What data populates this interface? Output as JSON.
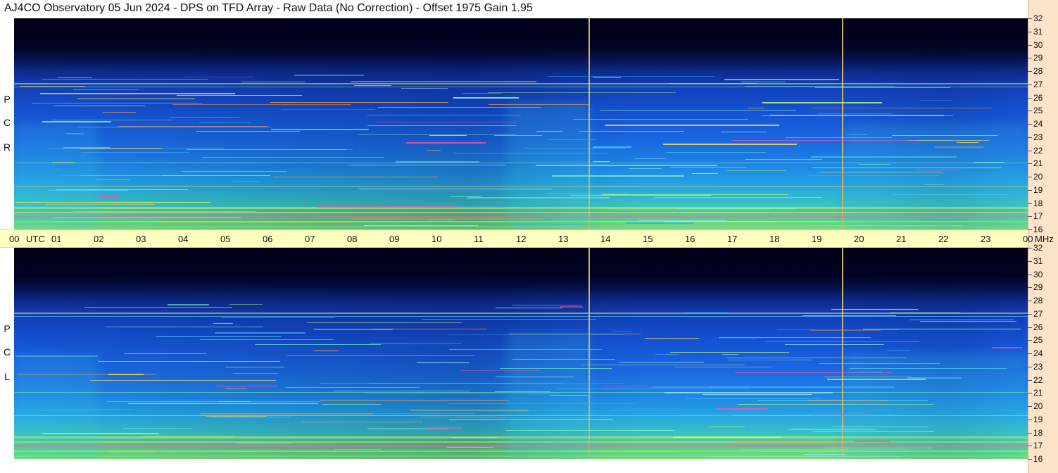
{
  "title": "AJ4CO Observatory  05 Jun 2024  -  DPS on TFD Array  -  Raw Data (No Correction)  -  Offset 1975  Gain 1.95",
  "panels": {
    "top": {
      "label_letters": [
        "P",
        "C",
        "R"
      ]
    },
    "bottom": {
      "label_letters": [
        "P",
        "C",
        "L"
      ]
    }
  },
  "time_axis": {
    "hours": [
      "00",
      "01",
      "02",
      "03",
      "04",
      "05",
      "06",
      "07",
      "08",
      "09",
      "10",
      "11",
      "12",
      "13",
      "14",
      "15",
      "16",
      "17",
      "18",
      "19",
      "20",
      "21",
      "22",
      "23",
      "00"
    ],
    "unit": "UTC"
  },
  "freq_axis": {
    "values": [
      "32",
      "31",
      "30",
      "29",
      "28",
      "27",
      "26",
      "25",
      "24",
      "23",
      "22",
      "21",
      "20",
      "19",
      "18",
      "17",
      "16"
    ],
    "unit": "MHz"
  },
  "colors": {
    "axis_bg": "#ffffc0",
    "right_strip": "#fde3c9",
    "marker": "#c9b26b"
  }
}
